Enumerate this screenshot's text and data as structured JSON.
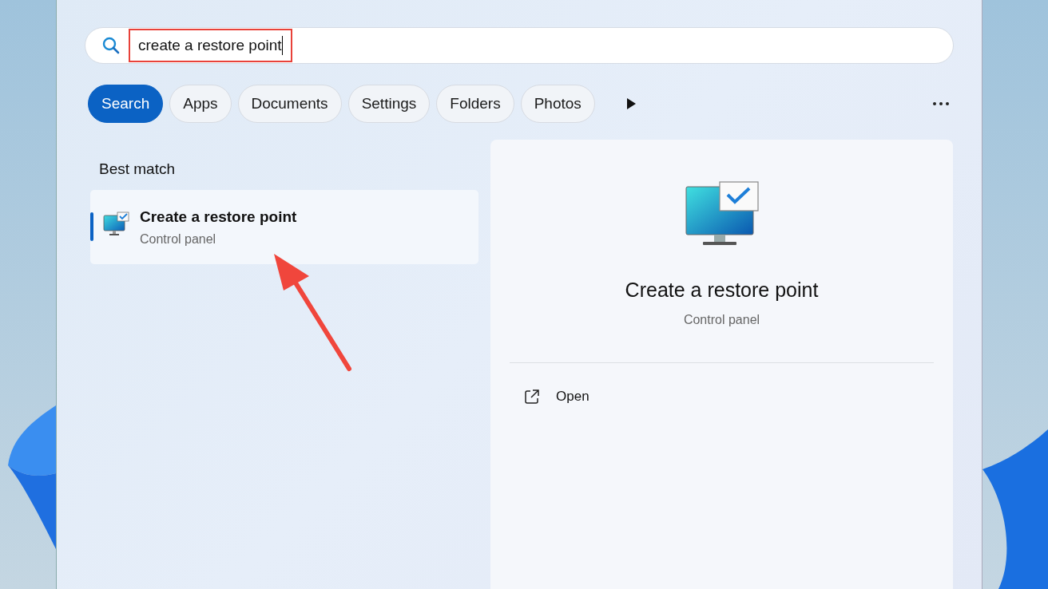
{
  "search": {
    "value": "create a restore point",
    "highlighted": true
  },
  "filters": [
    {
      "label": "Search",
      "selected": true
    },
    {
      "label": "Apps",
      "selected": false
    },
    {
      "label": "Documents",
      "selected": false
    },
    {
      "label": "Settings",
      "selected": false
    },
    {
      "label": "Folders",
      "selected": false
    },
    {
      "label": "Photos",
      "selected": false
    }
  ],
  "section_title": "Best match",
  "results": [
    {
      "title": "Create a restore point",
      "subtitle": "Control panel",
      "selected": true
    }
  ],
  "preview": {
    "title": "Create a restore point",
    "subtitle": "Control panel",
    "actions": [
      {
        "label": "Open"
      }
    ]
  }
}
